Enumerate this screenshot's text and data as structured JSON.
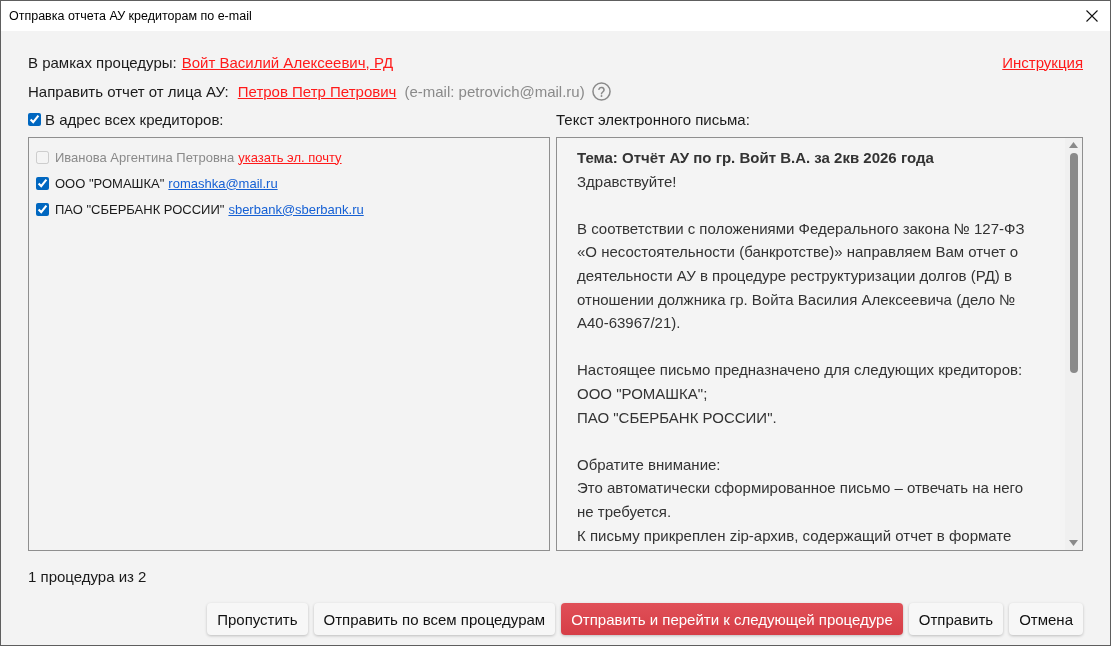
{
  "window": {
    "title": "Отправка отчета АУ кредиторам по e-mail"
  },
  "procedure": {
    "label": "В рамках процедуры:",
    "link": "Войт Василий Алексеевич, РД"
  },
  "instruction_link": "Инструкция",
  "sender": {
    "label": "Направить отчет от лица АУ:",
    "link": "Петров Петр Петрович",
    "email_note": "(e-mail: petrovich@mail.ru)"
  },
  "all_creditors": {
    "label": "В адрес всех кредиторов:",
    "checked": true
  },
  "creditors": [
    {
      "name": "Иванова Аргентина Петровна",
      "kind": "no-email",
      "checked": false,
      "disabled": true,
      "link": "указать эл. почту"
    },
    {
      "name": "ООО \"РОМАШКА\"",
      "kind": "email",
      "checked": true,
      "disabled": false,
      "link": "romashka@mail.ru"
    },
    {
      "name": "ПАО \"СБЕРБАНК РОССИИ\"",
      "kind": "email",
      "checked": true,
      "disabled": false,
      "link": "sberbank@sberbank.ru"
    }
  ],
  "letter": {
    "label": "Текст электронного письма:",
    "subject": "Тема: Отчёт АУ по гр. Войт В.А. за 2кв 2026 года",
    "paragraphs": [
      {
        "lines": [
          "Здравствуйте!"
        ]
      },
      {
        "lines": [
          "В соответствии с положениями Федерального закона № 127-ФЗ",
          "«О несостоятельности (банкротстве)» направляем Вам отчет о",
          "деятельности АУ в процедуре реструктуризации долгов (РД) в",
          "отношении должника гр. Войта Василия Алексеевича (дело №",
          "А40-63967/21)."
        ]
      },
      {
        "lines": [
          "Настоящее письмо предназначено для следующих кредиторов:",
          "ООО \"РОМАШКА\";",
          "ПАО \"СБЕРБАНК РОССИИ\"."
        ]
      },
      {
        "lines": [
          "Обратите внимание:",
          "Это автоматически сформированное письмо – отвечать на него",
          "не требуется.",
          "К письму прикреплен zip-архив, содержащий отчет в формате"
        ]
      }
    ]
  },
  "status": "1 процедура из 2",
  "buttons": [
    {
      "label": "Пропустить",
      "kind": "default"
    },
    {
      "label": "Отправить по всем процедурам",
      "kind": "default"
    },
    {
      "label": "Отправить и перейти к следующей процедуре",
      "kind": "primary"
    },
    {
      "label": "Отправить",
      "kind": "default"
    },
    {
      "label": "Отмена",
      "kind": "default"
    }
  ]
}
